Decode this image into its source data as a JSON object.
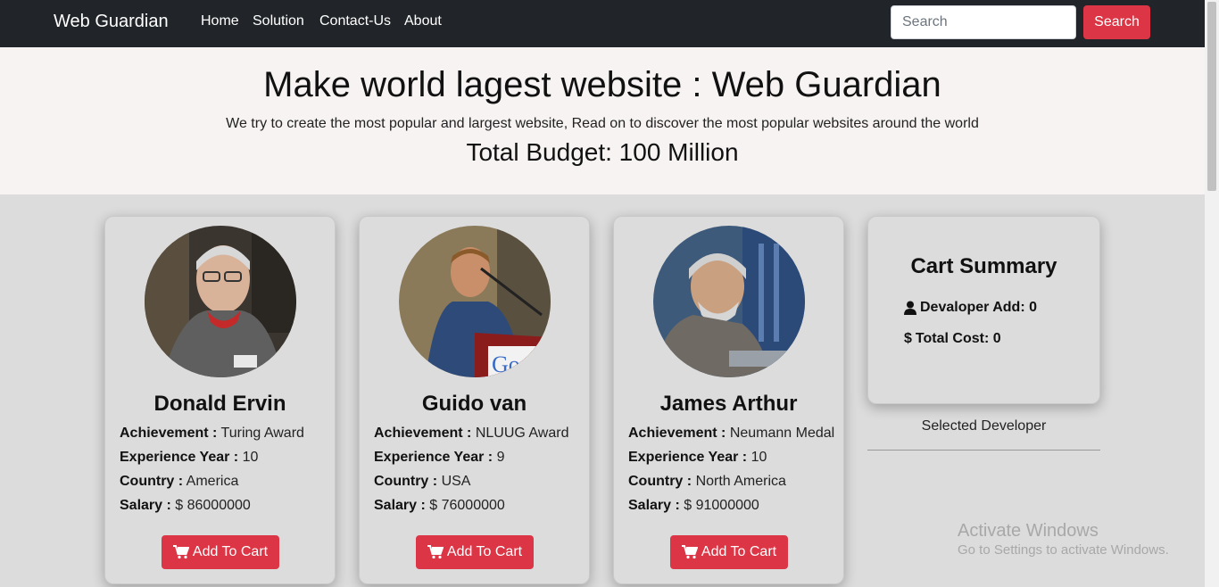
{
  "navbar": {
    "brand": "Web Guardian",
    "links": [
      "Home",
      "Solution",
      "Contact-Us",
      "About"
    ],
    "search_placeholder": "Search",
    "search_button": "Search"
  },
  "hero": {
    "title": "Make world lagest website : Web Guardian",
    "subtitle": "We try to create the most popular and largest website, Read on to discover the most popular websites around the world",
    "budget": "Total Budget: 100 Million"
  },
  "labels": {
    "achievement": "Achievement :",
    "experience": "Experience Year :",
    "country": "Country :",
    "salary": "Salary :"
  },
  "developers": [
    {
      "name": "Donald Ervin",
      "achievement": "Turing Award",
      "experience": "10",
      "country": "America",
      "salary": "$ 86000000",
      "button": "Add To Cart"
    },
    {
      "name": "Guido van",
      "achievement": "NLUUG Award",
      "experience": "9",
      "country": "USA",
      "salary": "$ 76000000",
      "button": "Add To Cart"
    },
    {
      "name": "James Arthur",
      "achievement": "Neumann Medal",
      "experience": "10",
      "country": "North America",
      "salary": "$ 91000000",
      "button": "Add To Cart"
    }
  ],
  "cart_summary": {
    "title": "Cart Summary",
    "developer_add": "Devaloper Add: 0",
    "total_cost": "Total Cost: 0",
    "selected_label": "Selected Developer"
  },
  "watermark": {
    "line1": "Activate Windows",
    "line2": "Go to Settings to activate Windows."
  },
  "colors": {
    "navbar": "#212529",
    "accent_red": "#dc3545",
    "hero_bg": "#f7f3f2",
    "page_bg": "#dcdcdc"
  },
  "icons": {
    "cart": "shopping-cart-icon",
    "user": "user-icon",
    "dollar": "dollar-icon"
  }
}
